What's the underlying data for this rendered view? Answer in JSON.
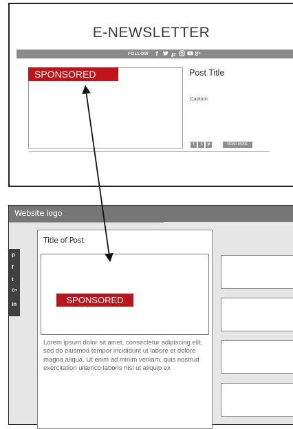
{
  "newsletter": {
    "title": "E-NEWSLETTER",
    "follow_label": "FOLLOW",
    "follow_icons": [
      "facebook-icon",
      "twitter-icon",
      "pinterest-icon",
      "instagram-icon",
      "youtube-icon",
      "google-plus-icon"
    ],
    "sponsored_label": "SPONSORED",
    "post_title": "Post Title",
    "caption": "Caption",
    "share_buttons": [
      "f",
      "t",
      "p"
    ],
    "read_more_label": "READ MORE"
  },
  "website": {
    "logo_text": "Website logo",
    "social_rail": [
      "p",
      "f",
      "t",
      "G+",
      "in"
    ],
    "article_title": "Title of Post",
    "sponsored_label": "SPONSORED",
    "body_text": "Lorem ipsum dolor sit amet, consectetur adipiscing elit, sed do eiusmod tempor incididunt ut labore et dolore magna aliqua. Ut enim ad minim veniam, quis nostrud exercitation ullamco laboris nisi ut aliquip ex"
  },
  "colors": {
    "sponsored_red": "#c0141b",
    "bar_gray": "#8a8a8a",
    "header_gray": "#777777"
  }
}
